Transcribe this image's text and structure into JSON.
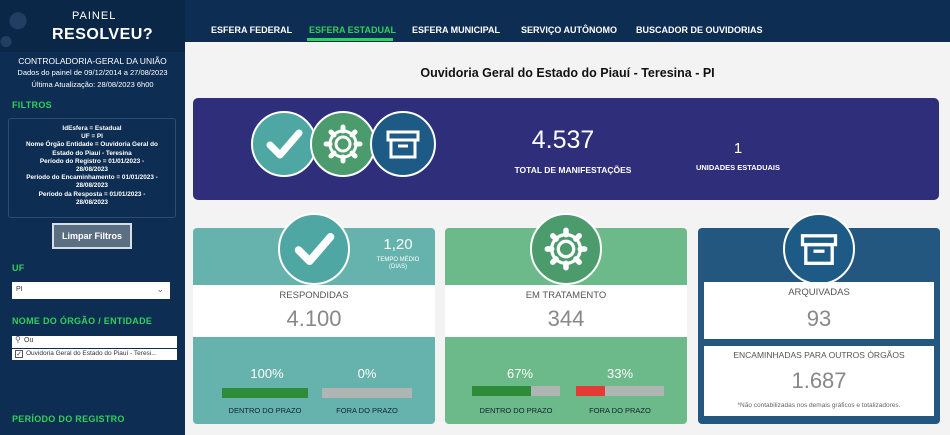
{
  "sidebar": {
    "title_line1": "PAINEL",
    "title_line2": "RESOLVEU?",
    "org": "CONTROLADORIA-GERAL DA UNIÃO",
    "data_range": "Dados do painel de 09/12/2014 a 27/08/2023",
    "last_update": "Última Atualização: 28/08/2023 6h00",
    "filters_heading": "FILTROS",
    "filters": [
      "IdEsfera = Estadual",
      "UF = PI",
      "Nome Órgão Entidade = Ouvidoria Geral do",
      "Estado do Piauí - Teresina",
      "Período do Registro = 01/01/2023 -",
      "28/08/2023",
      "Período do Encaminhamento = 01/01/2023 -",
      "28/08/2023",
      "Período da Resposta = 01/01/2023 -",
      "28/08/2023"
    ],
    "clear_button": "Limpar Filtros",
    "uf_heading": "UF",
    "uf_value": "PI",
    "org_heading": "NOME DO ÓRGÃO / ENTIDADE",
    "search_value": "Ou",
    "org_option": "Ouvidoria Geral do Estado do Piauí - Teresi...",
    "period_heading": "PERÍODO DO REGISTRO"
  },
  "nav": {
    "tabs": [
      "ESFERA FEDERAL",
      "ESFERA ESTADUAL",
      "ESFERA MUNICIPAL",
      "SERVIÇO AUTÔNOMO",
      "BUSCADOR DE OUVIDORIAS"
    ]
  },
  "page": {
    "title": "Ouvidoria Geral do Estado do Piauí - Teresina - PI"
  },
  "banner": {
    "total_value": "4.537",
    "total_label": "TOTAL DE MANIFESTAÇÕES",
    "units_value": "1",
    "units_label": "UNIDADES ESTADUAIS"
  },
  "cards": {
    "respondidas": {
      "label": "RESPONDIDAS",
      "value": "4.100",
      "avg_time_value": "1,20",
      "avg_time_label": "TEMPO MÉDIO (DIAS)",
      "in_time_pct": "100%",
      "in_time_fraction": 1.0,
      "in_time_label": "DENTRO DO PRAZO",
      "out_time_pct": "0%",
      "out_time_fraction": 0.0,
      "out_time_label": "FORA DO PRAZO"
    },
    "tratamento": {
      "label": "EM TRATAMENTO",
      "value": "344",
      "in_time_pct": "67%",
      "in_time_fraction": 0.67,
      "in_time_label": "DENTRO DO PRAZO",
      "out_time_pct": "33%",
      "out_time_fraction": 0.33,
      "out_time_label": "FORA DO PRAZO"
    },
    "arquivadas": {
      "label": "ARQUIVADAS",
      "value": "93",
      "forward_label": "ENCAMINHADAS PARA OUTROS ÓRGÃOS",
      "forward_value": "1.687",
      "note": "*Não contabilizadas nos demais gráficos e totalizadores."
    }
  },
  "colors": {
    "nav_bg": "#0d2e52",
    "accent_green": "#2fd15a",
    "banner_bg": "#2f2e7a",
    "teal": "#66b3ae",
    "green": "#6cb98a",
    "navy": "#24577f",
    "bar_green": "#2e8b3a",
    "bar_red": "#e53935"
  }
}
